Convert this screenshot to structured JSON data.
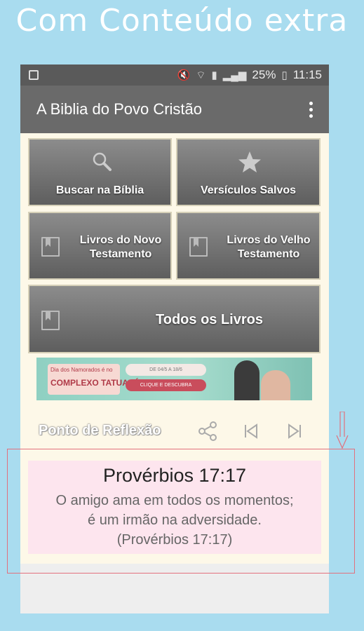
{
  "promo": {
    "title": "Com Conteúdo extra"
  },
  "statusbar": {
    "battery": "25%",
    "time": "11:15"
  },
  "appbar": {
    "title": "A Biblia do Povo Cristão"
  },
  "menu": {
    "search": "Buscar na Bíblia",
    "saved": "Versículos Salvos",
    "new_testament": "Livros do Novo Testamento",
    "old_testament": "Livros do Velho Testamento",
    "all_books": "Todos os Livros"
  },
  "ad": {
    "line1": "Dia dos Namorados é no",
    "line2": "COMPLEXO TATUAPÉ",
    "dates": "DE 04/5 A 18/6",
    "cta": "CLIQUE E DESCUBRA"
  },
  "reflection": {
    "label": "Ponto de Reflexão"
  },
  "verse": {
    "reference": "Provérbios 17:17",
    "line1": "O amigo ama em todos os momentos;",
    "line2": "é um irmão na adversidade.",
    "citation": "(Provérbios 17:17)"
  }
}
